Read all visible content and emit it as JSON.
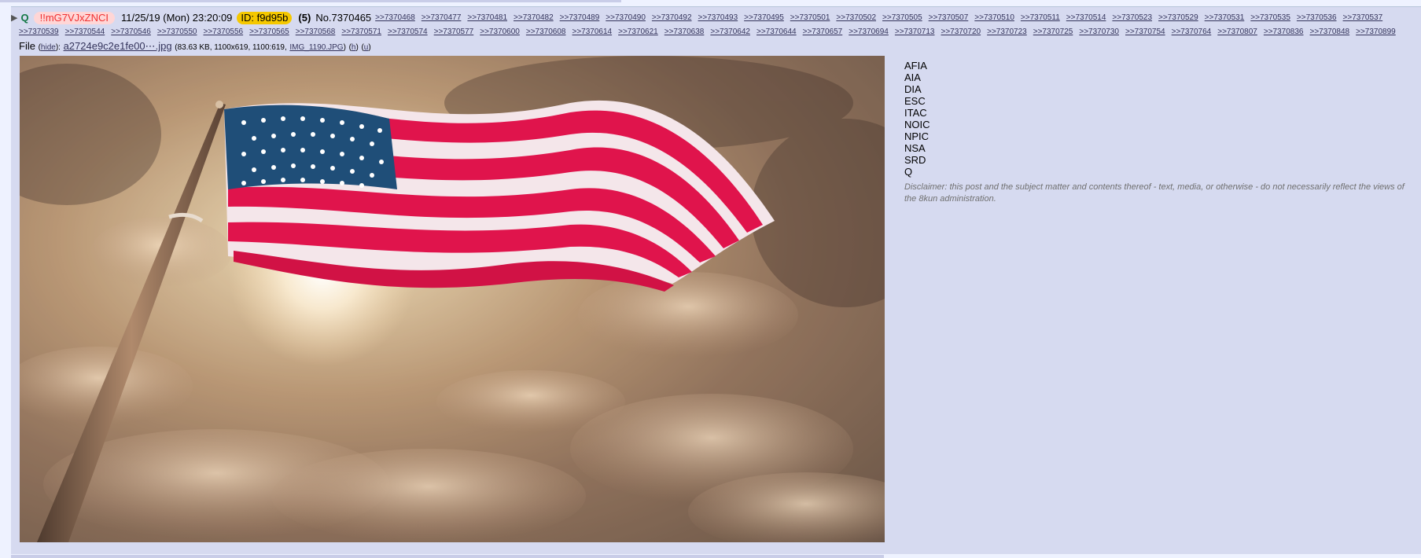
{
  "post": {
    "name": "Q",
    "tripcode": "!!mG7VJxZNCI",
    "date": "11/25/19 (Mon) 23:20:09",
    "id_label": "ID: f9d95b",
    "reply_count": "(5)",
    "post_number": "No.7370465",
    "backlinks": [
      ">>7370468",
      ">>7370477",
      ">>7370481",
      ">>7370482",
      ">>7370489",
      ">>7370490",
      ">>7370492",
      ">>7370493",
      ">>7370495",
      ">>7370501",
      ">>7370502",
      ">>7370505",
      ">>7370507",
      ">>7370510",
      ">>7370511",
      ">>7370514",
      ">>7370523",
      ">>7370529",
      ">>7370531",
      ">>7370535",
      ">>7370536",
      ">>7370537",
      ">>7370539",
      ">>7370544",
      ">>7370546",
      ">>7370550",
      ">>7370556",
      ">>7370565",
      ">>7370568",
      ">>7370571",
      ">>7370574",
      ">>7370577",
      ">>7370600",
      ">>7370608",
      ">>7370614",
      ">>7370621",
      ">>7370638",
      ">>7370642",
      ">>7370644",
      ">>7370657",
      ">>7370694",
      ">>7370713",
      ">>7370720",
      ">>7370723",
      ">>7370725",
      ">>7370730",
      ">>7370754",
      ">>7370764",
      ">>7370807",
      ">>7370836",
      ">>7370848",
      ">>7370899"
    ],
    "file": {
      "label": "File",
      "hide_label": "hide",
      "filename": "a2724e9c2e1fe00⋯.jpg",
      "info": "(83.63 KB, 1100x619, 1100:619,",
      "original_name": "IMG_1190.JPG",
      "suffix": ")",
      "h_link": "h",
      "u_link": "u"
    },
    "body_lines": [
      "AFIA",
      "AIA",
      "DIA",
      "ESC",
      "ITAC",
      "NOIC",
      "NPIC",
      "NSA",
      "SRD",
      "Q"
    ],
    "disclaimer": "Disclaimer: this post and the subject matter and contents thereof - text, media, or otherwise - do not necessarily reflect the views of the 8kun administration."
  },
  "colors": {
    "background": "#eef2ff",
    "post_background": "#d6daf0",
    "link": "#34345c",
    "name": "#117743",
    "tripcode": "#f03030",
    "id_badge": "#f5c800"
  }
}
